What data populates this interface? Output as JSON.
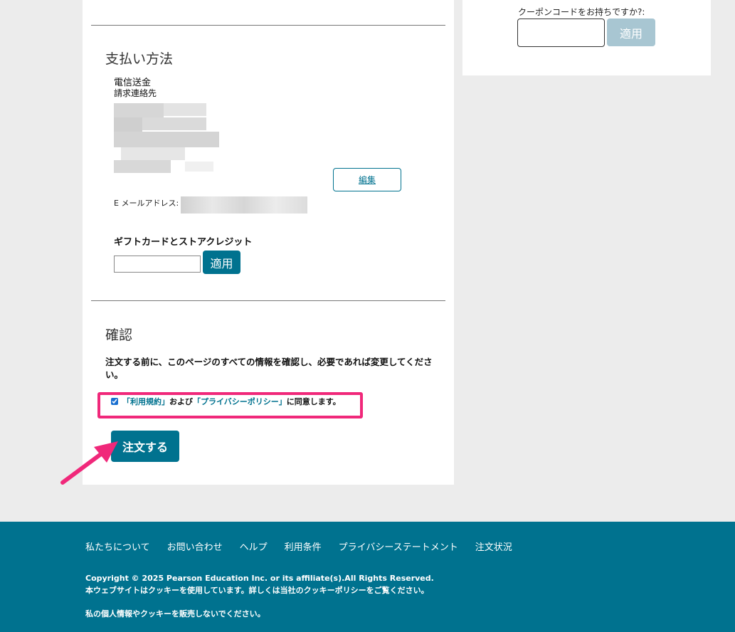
{
  "coupon": {
    "label": "クーポンコードをお持ちですか?:",
    "apply_label": "適用"
  },
  "payment": {
    "title": "支払い方法",
    "method": "電信送金",
    "billing_contact": "請求連絡先",
    "edit_label": "編集",
    "email_label": "E メールアドレス:"
  },
  "gift": {
    "title": "ギフトカードとストアクレジット",
    "apply_label": "適用"
  },
  "confirm": {
    "title": "確認",
    "note": "注文する前に、このページのすべての情報を確認し、必要であれば変更してください。",
    "agree": {
      "terms_link": "「利用規約」",
      "and_text": "および",
      "privacy_link": "「プライバシーポリシー」",
      "suffix": "に同意します。",
      "checked": true
    },
    "order_label": "注文する"
  },
  "footer": {
    "links": [
      "私たちについて",
      "お問い合わせ",
      "ヘルプ",
      "利用条件",
      "プライバシーステートメント",
      "注文状況"
    ],
    "copyright": "Copyright © 2025 Pearson Education Inc. or its affiliate(s).All Rights Reserved.",
    "cookie_notice": "本ウェブサイトはクッキーを使用しています。詳しくは当社のクッキーポリシーをご覧ください。",
    "privacy_notice": "私の個人情報やクッキーを販売しないでください。"
  },
  "colors": {
    "brand": "#00728f",
    "highlight": "#f0287a",
    "disabled_button": "#a8c6d2"
  }
}
